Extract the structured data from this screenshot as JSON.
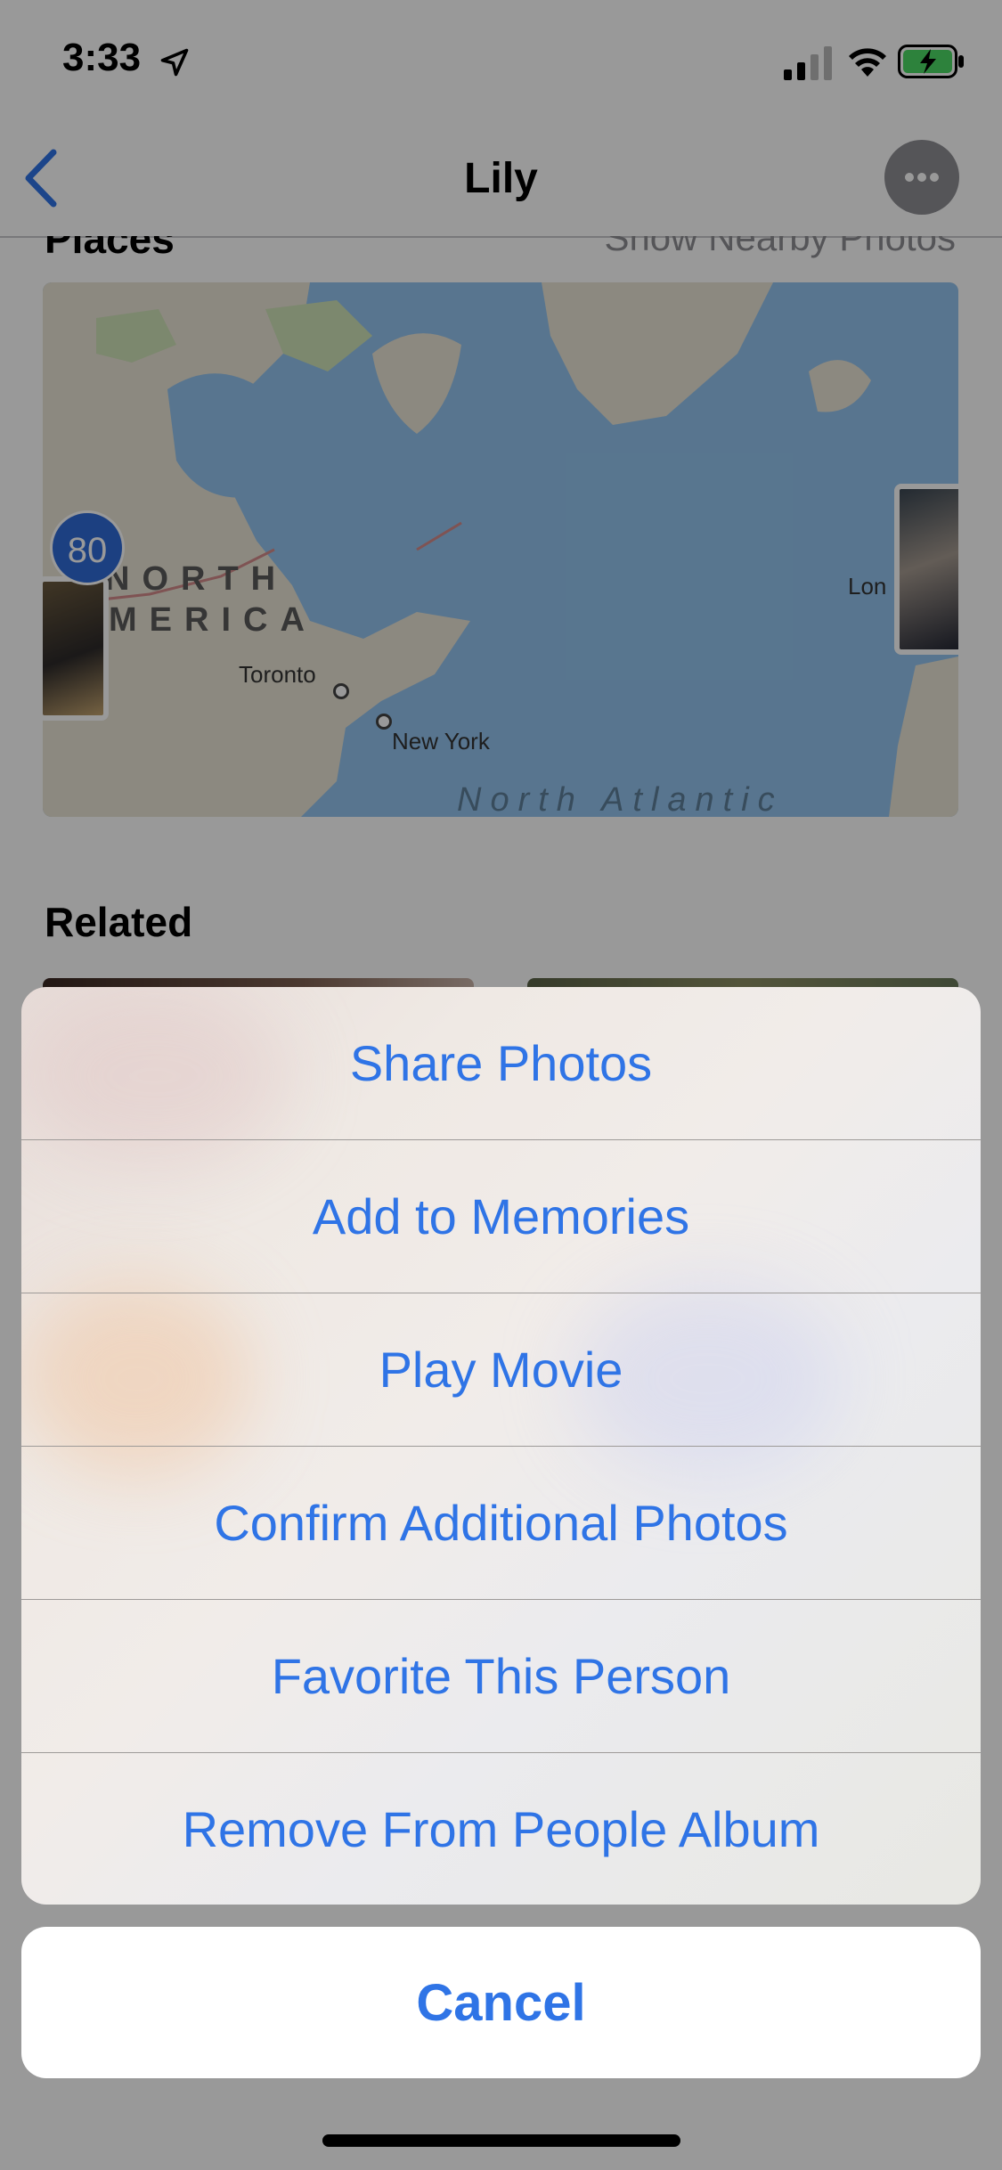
{
  "status_bar": {
    "time": "3:33",
    "icons": [
      "location-arrow-icon",
      "cellular-signal-icon",
      "wifi-icon",
      "battery-charging-icon"
    ]
  },
  "nav": {
    "title": "Lily",
    "back_icon": "chevron-left-icon",
    "more_icon": "ellipsis-icon"
  },
  "places": {
    "title": "Places",
    "link": "Show Nearby Photos",
    "map": {
      "region_label_1": "NORTH",
      "region_label_2": "MERICA",
      "ocean_label": "North Atlantic",
      "cities": [
        "Toronto",
        "New York",
        "Lon"
      ],
      "cluster_count": "80"
    }
  },
  "related": {
    "title": "Related"
  },
  "action_sheet": {
    "items": [
      {
        "label": "Share Photos"
      },
      {
        "label": "Add to Memories"
      },
      {
        "label": "Play Movie"
      },
      {
        "label": "Confirm Additional Photos"
      },
      {
        "label": "Favorite This Person"
      },
      {
        "label": "Remove From People Album"
      }
    ],
    "cancel_label": "Cancel"
  },
  "colors": {
    "accent": "#2f74e6",
    "map_water": "#93c4ef",
    "map_land": "#e9e4d6",
    "cluster_badge": "#2f6bd8"
  }
}
